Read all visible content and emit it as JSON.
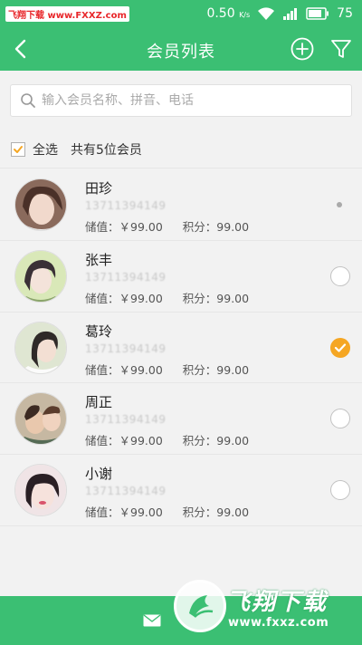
{
  "watermark_top": {
    "part1": "飞翔下载",
    "part2": " www.FXXZ.com"
  },
  "status_bar": {
    "speed_value": "0.50",
    "speed_unit": "K/s",
    "battery": "75"
  },
  "header": {
    "title": "会员列表"
  },
  "search": {
    "placeholder": "输入会员名称、拼音、电话"
  },
  "select_bar": {
    "select_all_label": "全选",
    "count_label": "共有5位会员"
  },
  "members": [
    {
      "name": "田珍",
      "phone": "13711394149",
      "balance": "储值：￥99.00",
      "points": "积分：99.00",
      "state": "dot"
    },
    {
      "name": "张丰",
      "phone": "13711394149",
      "balance": "储值：￥99.00",
      "points": "积分：99.00",
      "state": "unchecked"
    },
    {
      "name": "葛玲",
      "phone": "13711394149",
      "balance": "储值：￥99.00",
      "points": "积分：99.00",
      "state": "checked"
    },
    {
      "name": "周正",
      "phone": "13711394149",
      "balance": "储值：￥99.00",
      "points": "积分：99.00",
      "state": "unchecked"
    },
    {
      "name": "小谢",
      "phone": "13711394149",
      "balance": "储值：￥99.00",
      "points": "积分：99.00",
      "state": "unchecked"
    }
  ],
  "watermark_bottom": {
    "brand": "飞翔下载",
    "url": "www.fxxz.com"
  },
  "colors": {
    "primary": "#3bbf73",
    "accent": "#f5a623",
    "background": "#f2f2f2"
  },
  "icons": [
    "back-arrow-icon",
    "add-circle-icon",
    "filter-icon",
    "search-icon",
    "checkbox-check-icon",
    "checkmark-icon",
    "mail-icon",
    "wifi-icon",
    "signal-icon",
    "battery-icon"
  ]
}
